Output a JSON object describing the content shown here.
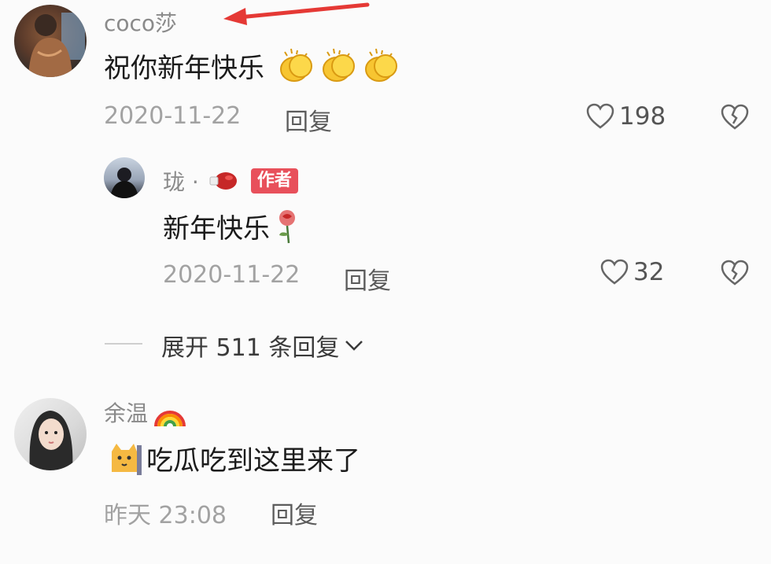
{
  "comments": [
    {
      "username": "coco莎",
      "text": "祝你新年快乐",
      "emojis": [
        "clapping-hands-icon",
        "clapping-hands-icon",
        "clapping-hands-icon"
      ],
      "date": "2020-11-22",
      "reply_label": "回复",
      "likes": "198",
      "reply": {
        "username": "珑 ·",
        "badge": "作者",
        "text": "新年快乐",
        "emoji": "rose-icon",
        "date": "2020-11-22",
        "reply_label": "回复",
        "likes": "32"
      },
      "expand_label": "展开 511 条回复"
    },
    {
      "username": "余温",
      "username_emoji": "rainbow-icon",
      "text": "吃瓜吃到这里来了",
      "lead_emoji": "cat-icon",
      "date": "昨天 23:08",
      "reply_label": "回复"
    }
  ],
  "colors": {
    "arrow": "#e53935",
    "badge": "#e8505b",
    "background": "#fbfbfb"
  }
}
